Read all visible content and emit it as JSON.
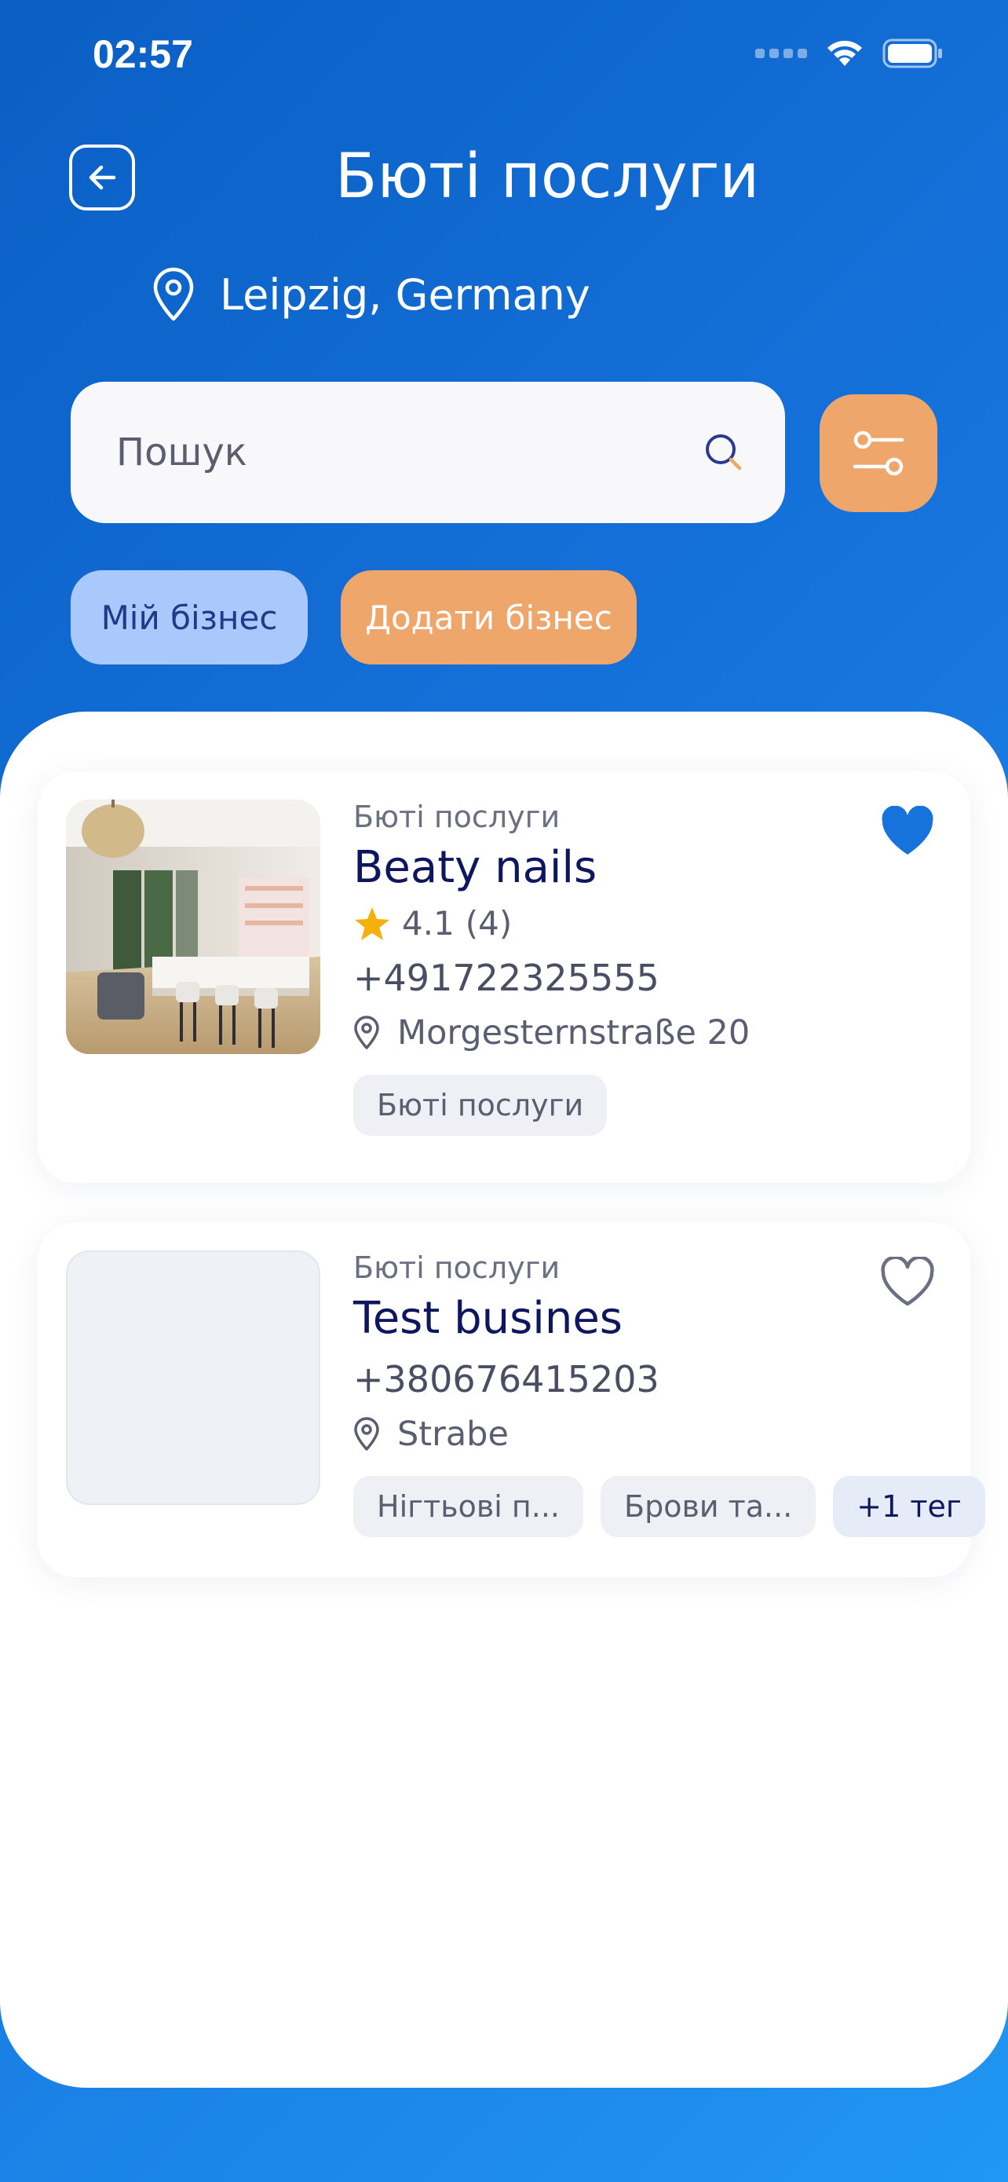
{
  "status_bar": {
    "time": "02:57"
  },
  "header": {
    "title": "Бюті послуги",
    "location": "Leipzig, Germany"
  },
  "search": {
    "placeholder": "Пошук"
  },
  "actions": {
    "my_business": "Мій бізнес",
    "add_business": "Додати бізнес"
  },
  "colors": {
    "accent": "#efa66a",
    "primary": "#0a5fc4",
    "heart": "#1673dc",
    "star": "#f5b10b"
  },
  "businesses": [
    {
      "category": "Бюті послуги",
      "name": "Beaty nails",
      "rating": "4.1",
      "reviews": "(4)",
      "phone": "+491722325555",
      "address": "Morgesternstraße 20",
      "tags": [
        "Бюті послуги"
      ],
      "favorite": true
    },
    {
      "category": "Бюті послуги",
      "name": "Test busines",
      "phone": "+380676415203",
      "address": "Strabe",
      "tags": [
        "Нігтьові п...",
        "Брови та..."
      ],
      "more_tags": "+1 тег",
      "favorite": false
    }
  ]
}
